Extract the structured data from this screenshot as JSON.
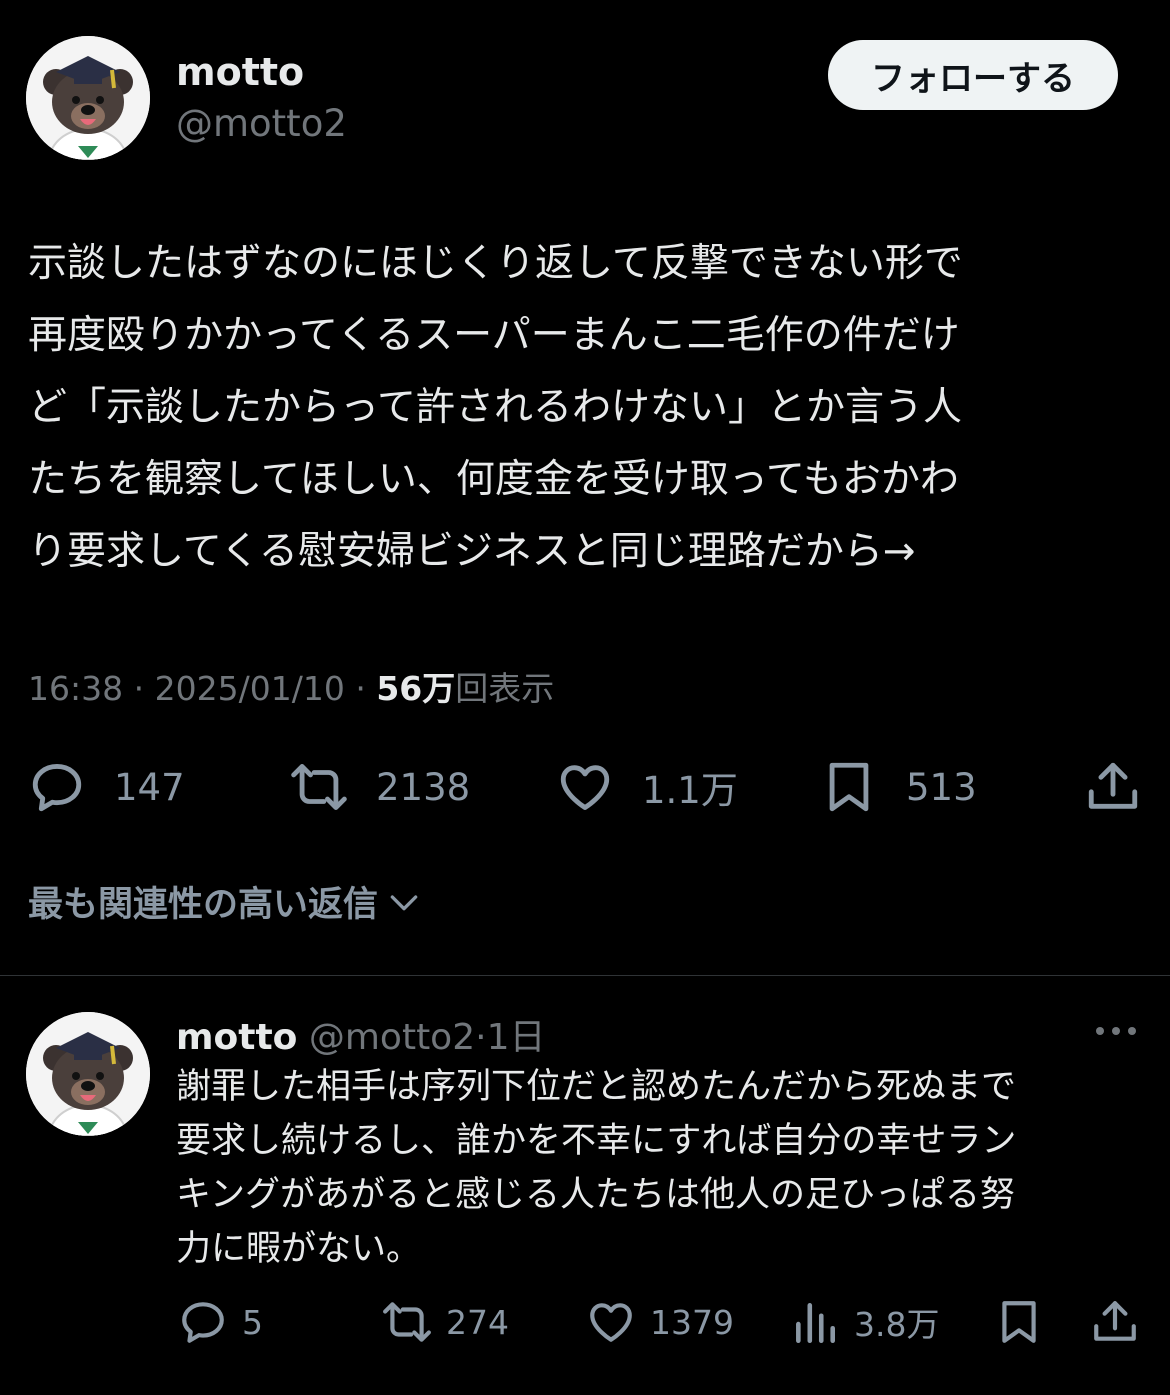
{
  "post": {
    "author_name": "motto",
    "author_handle": "@motto2",
    "follow_label": "フォローする",
    "text": "示談したはずなのにほじくり返して反撃できない形で\n再度殴りかかってくるスーパーまんこ二毛作の件だけ\nど「示談したからって許されるわけない」とか言う人\nたちを観察してほしい、何度金を受け取ってもおかわ\nり要求してくる慰安婦ビジネスと同じ理路だから→",
    "time": "16:38",
    "date": "2025/01/10",
    "views_count": "56万",
    "views_label": "回表示",
    "separator": "·",
    "stats": {
      "replies": "147",
      "reposts": "2138",
      "likes": "1.1万",
      "bookmarks": "513"
    }
  },
  "replies_sort": {
    "label": "最も関連性の高い返信"
  },
  "reply": {
    "author_name": "motto",
    "author_handle": "@motto2",
    "separator": "·",
    "age": "1日",
    "text": "謝罪した相手は序列下位だと認めたんだから死ぬまで\n要求し続けるし、誰かを不幸にすれば自分の幸せラン\nキングがあがると感じる人たちは他人の足ひっぱる努\n力に暇がない。",
    "stats": {
      "replies": "5",
      "reposts": "274",
      "likes": "1379",
      "views": "3.8万"
    }
  },
  "icons": {
    "reply": "reply-icon",
    "repost": "repost-icon",
    "like": "heart-icon",
    "bookmark": "bookmark-icon",
    "share": "share-icon",
    "views": "views-chart-icon",
    "more": "more-dots-icon",
    "chevron": "chevron-down-icon"
  },
  "colors": {
    "background": "#000000",
    "text": "#e7e9ea",
    "secondary": "#71767b",
    "icon": "#8b98a5",
    "button_bg": "#eff3f4",
    "divider": "#2f3336"
  }
}
